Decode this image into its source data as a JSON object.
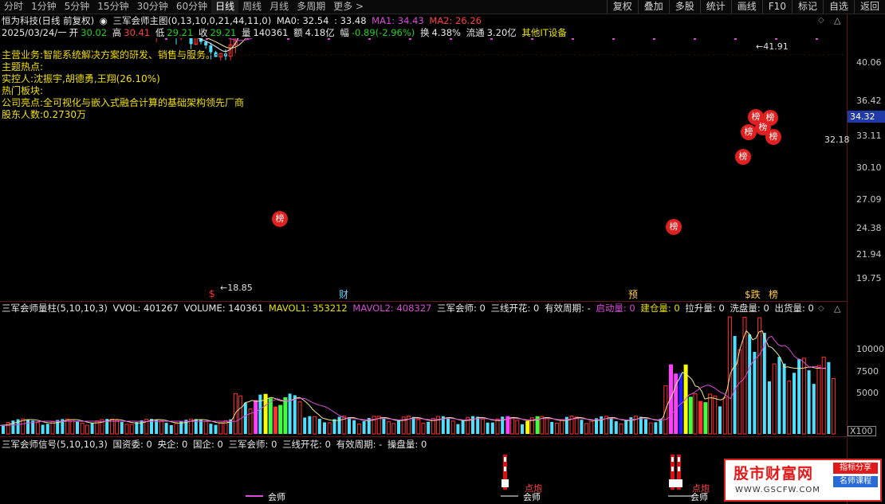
{
  "toolbar": {
    "periods": [
      "分时",
      "1分钟",
      "5分钟",
      "15分钟",
      "30分钟",
      "60分钟",
      "日线",
      "周线",
      "月线",
      "多周期",
      "更多"
    ],
    "active_period": "日线",
    "more_arrow": ">",
    "tools": [
      "复权",
      "叠加",
      "多股",
      "统计",
      "画线",
      "F10",
      "标记",
      "自选",
      "返回"
    ]
  },
  "main_header": {
    "stock": "恒为科技(日线 前复权)",
    "indicator": "三军会师主图(0,13,10,0,21,44,11,0)",
    "ma0_label": "MA0: 32.54",
    "ma0_extra": ": 33.48",
    "ma1_label": "MA1: 34.43",
    "ma2_label": "MA2: 26.26"
  },
  "quote_row": {
    "date": "2025/03/24/一",
    "open_label": "开",
    "open": "30.02",
    "high_label": "高",
    "high": "30.41",
    "low_label": "低",
    "low": "29.21",
    "close_label": "收",
    "close": "29.21",
    "volume_label": "量",
    "volume": "140361",
    "amount_label": "额",
    "amount": "4.18亿",
    "change_label": "幅",
    "change": "-0.89(-2.96%)",
    "turnover_label": "换",
    "turnover": "4.38%",
    "float_label": "流通",
    "float": "3.20亿",
    "sector": "其他IT设备"
  },
  "info_lines": [
    "主营业务:智能系统解决方案的研发、销售与服务。",
    "主题热点:",
    "实控人:沈振宇,胡德勇,王翔(26.10%)",
    "热门板块:",
    "公司亮点:全可视化与嵌入式融合计算的基础架构领先厂商",
    "股东人数:0.2730万"
  ],
  "price_axis": [
    "40.06",
    "36.42",
    "33.11",
    "30.10",
    "27.09",
    "24.38",
    "21.94",
    "19.75"
  ],
  "current_price": "34.32",
  "annotations": {
    "high_price": "41.91",
    "low_price": "18.85",
    "right_price": "32.18",
    "bang": "榜",
    "bottom_markers": [
      "$",
      "财",
      "预",
      "$跌",
      "榜"
    ]
  },
  "vol_header": {
    "name": "三军会师量柱(5,10,10,3)",
    "vvol": "VVOL: 401267",
    "volume": "VOLUME: 140361",
    "mavol1": "MAVOL1: 353212",
    "mavol2": "MAVOL2: 408327",
    "sjhs": "三军会师: 0",
    "sxkh": "三线开花: 0",
    "period": "有效周期: -",
    "qdl": "启动量: 0",
    "jcl": "建仓量: 0",
    "lsl": "拉升量: 0",
    "xpl": "洗盘量: 0",
    "chl": "出货量: 0"
  },
  "vol_axis": [
    "10000",
    "7500",
    "5000"
  ],
  "vol_unit": "X100",
  "sig_header": {
    "name": "三军会师信号(5,10,10,3)",
    "gzw": "国资委: 0",
    "yq": "央企: 0",
    "gq": "国企: 0",
    "sjhs": "三军会师: 0",
    "sxkh": "三线开花: 0",
    "period": "有效周期: -",
    "cpl": "操盘量: 0"
  },
  "signals": {
    "huishi": "会师",
    "dianpao": "点炮"
  },
  "watermark": {
    "title": "股市财富网",
    "tag1": "指标分享",
    "tag2": "名师课程",
    "url": "WWW.GSCFW.COM"
  },
  "colors": {
    "up": "#ff3030",
    "down": "#50e0ff",
    "ma_white": "#f0f0f0",
    "ma_yellow": "#f0e68c",
    "ma_magenta": "#c040c0",
    "ma_red": "#c01818"
  }
}
